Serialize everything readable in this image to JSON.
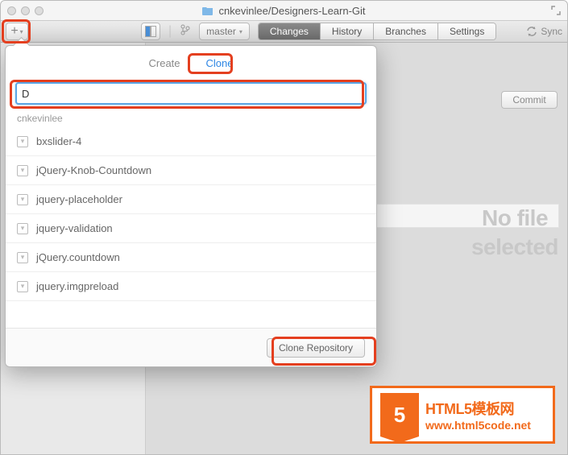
{
  "window": {
    "title": "cnkevinlee/Designers-Learn-Git"
  },
  "toolbar": {
    "branch": "master",
    "tabs": {
      "changes": "Changes",
      "history": "History",
      "branches": "Branches",
      "settings": "Settings"
    },
    "sync": "Sync"
  },
  "main": {
    "commit_btn": "Commit",
    "no_file": "No file selected"
  },
  "popover": {
    "tabs": {
      "create": "Create",
      "clone": "Clone"
    },
    "search_value": "D",
    "group": "cnkevinlee",
    "repos": [
      "bxslider-4",
      "jQuery-Knob-Countdown",
      "jquery-placeholder",
      "jquery-validation",
      "jQuery.countdown",
      "jquery.imgpreload"
    ],
    "clone_btn": "Clone Repository"
  },
  "watermark": {
    "badge": "5",
    "line1": "HTML5模板网",
    "line2": "www.html5code.net"
  }
}
